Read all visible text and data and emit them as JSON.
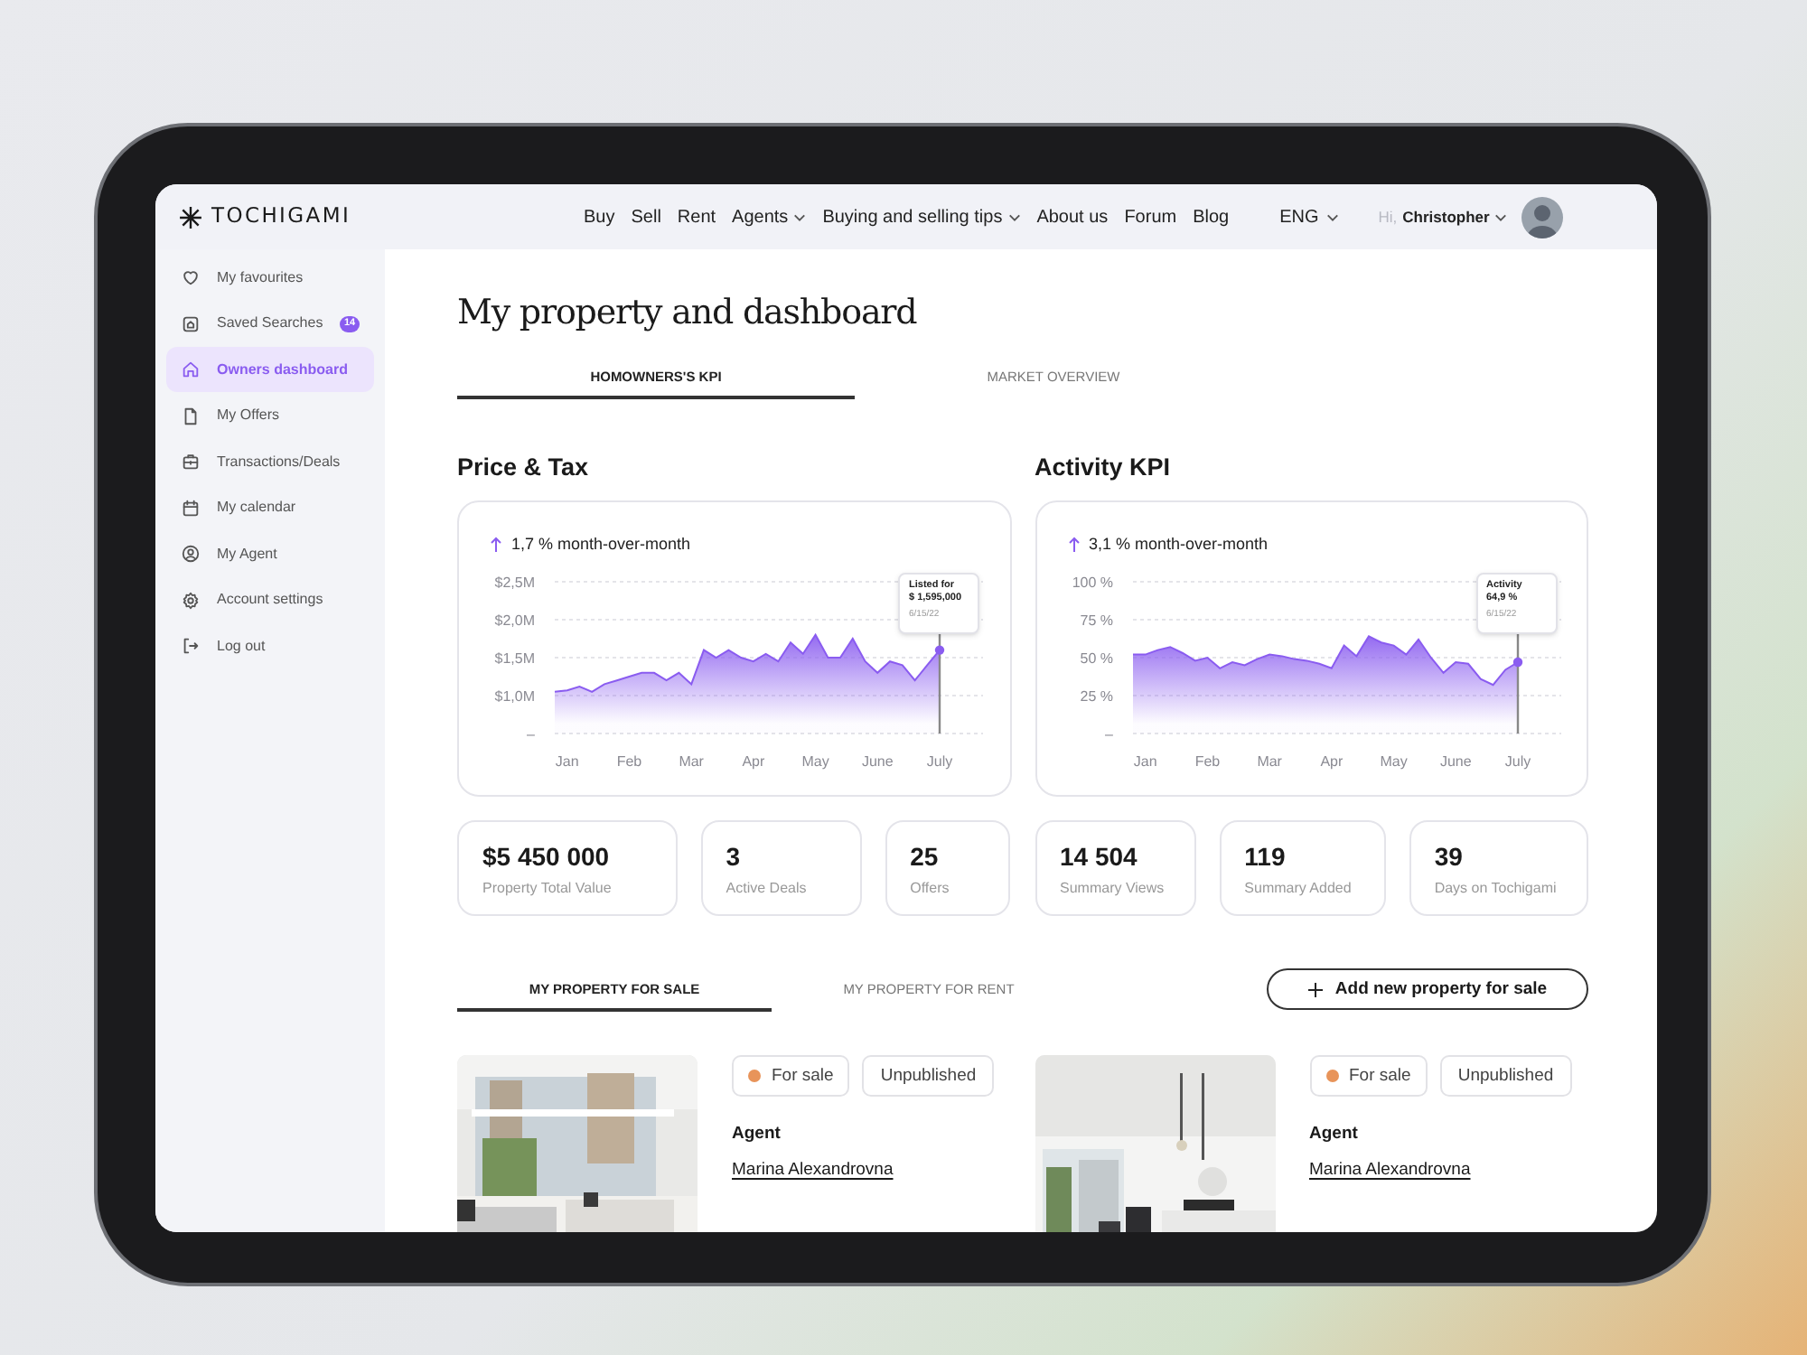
{
  "header": {
    "logo": "TOCHIGAMI",
    "nav": [
      {
        "label": "Buy",
        "dropdown": false
      },
      {
        "label": "Sell",
        "dropdown": false
      },
      {
        "label": "Rent",
        "dropdown": false
      },
      {
        "label": "Agents",
        "dropdown": true
      },
      {
        "label": "Buying and selling tips",
        "dropdown": true
      },
      {
        "label": "About us",
        "dropdown": false
      },
      {
        "label": "Forum",
        "dropdown": false
      },
      {
        "label": "Blog",
        "dropdown": false
      }
    ],
    "language": "ENG",
    "greeting": "Hi,",
    "user": "Christopher"
  },
  "sidebar": {
    "items": [
      {
        "label": "My favourites",
        "selected": false
      },
      {
        "label": "Saved Searches",
        "badge": "14",
        "selected": false
      },
      {
        "label": "Owners dashboard",
        "selected": true
      },
      {
        "label": "My Offers",
        "selected": false
      },
      {
        "label": "Transactions/Deals",
        "selected": false
      },
      {
        "label": "My calendar",
        "selected": false
      },
      {
        "label": "My Agent",
        "selected": false
      },
      {
        "label": "Account settings",
        "selected": false
      },
      {
        "label": "Log out",
        "selected": false
      }
    ]
  },
  "page_title": "My property and dashboard",
  "tabs": [
    {
      "label": "HOMOWNERS'S KPI",
      "selected": true
    },
    {
      "label": "MARKET OVERVIEW",
      "selected": false
    }
  ],
  "panels": [
    {
      "title": "Price & Tax",
      "change": "1,7 % month-over-month",
      "tooltip": {
        "label": "Listed for",
        "value": "$ 1,595,000",
        "date": "6/15/22"
      },
      "chart_data": {
        "type": "area",
        "grid": true,
        "ylim": [
          0.5,
          2.5
        ],
        "categories": [
          null,
          "Jan",
          null,
          null,
          null,
          null,
          "Feb",
          null,
          null,
          null,
          null,
          "Mar",
          null,
          null,
          null,
          null,
          "Apr",
          null,
          null,
          null,
          null,
          "May",
          null,
          null,
          null,
          null,
          "June",
          null,
          null,
          null,
          null,
          "July"
        ],
        "values": [
          1.05,
          1.07,
          1.12,
          1.05,
          1.15,
          1.2,
          1.25,
          1.3,
          1.3,
          1.2,
          1.3,
          1.15,
          1.6,
          1.5,
          1.6,
          1.5,
          1.45,
          1.55,
          1.45,
          1.7,
          1.55,
          1.8,
          1.5,
          1.5,
          1.75,
          1.45,
          1.3,
          1.45,
          1.4,
          1.2,
          1.4,
          1.6
        ],
        "yticks": [
          {
            "value": 0.5,
            "label": "–"
          },
          {
            "value": 1,
            "label": "$1,0M"
          },
          {
            "value": 1.5,
            "label": "$1,5M"
          },
          {
            "value": 2,
            "label": "$2,0M"
          },
          {
            "value": 2.5,
            "label": "$2,5M"
          }
        ]
      },
      "stats": [
        {
          "value": "$5 450 000",
          "label": "Property Total Value"
        },
        {
          "value": "3",
          "label": "Active Deals"
        },
        {
          "value": "25",
          "label": "Offers"
        }
      ]
    },
    {
      "title": "Activity KPI",
      "change": "3,1 % month-over-month",
      "tooltip": {
        "label": "Activity",
        "value": "64,9 %",
        "date": "6/15/22"
      },
      "chart_data": {
        "type": "area",
        "grid": true,
        "ylim": [
          0,
          100
        ],
        "categories": [
          null,
          "Jan",
          null,
          null,
          null,
          null,
          "Feb",
          null,
          null,
          null,
          null,
          "Mar",
          null,
          null,
          null,
          null,
          "Apr",
          null,
          null,
          null,
          null,
          "May",
          null,
          null,
          null,
          null,
          "June",
          null,
          null,
          null,
          null,
          "July"
        ],
        "values": [
          52,
          52,
          55,
          57,
          53,
          48,
          50,
          43,
          47,
          45,
          49,
          52,
          51,
          49,
          48,
          46,
          43,
          58,
          51,
          64,
          60,
          58,
          52,
          62,
          50,
          40,
          47,
          46,
          36,
          32,
          42,
          47
        ],
        "yticks": [
          {
            "value": 0,
            "label": "–"
          },
          {
            "value": 25,
            "label": "25 %"
          },
          {
            "value": 50,
            "label": "50 %"
          },
          {
            "value": 75,
            "label": "75 %"
          },
          {
            "value": 100,
            "label": "100 %"
          }
        ]
      },
      "stats": [
        {
          "value": "14 504",
          "label": "Summary Views"
        },
        {
          "value": "119",
          "label": "Summary Added"
        },
        {
          "value": "39",
          "label": "Days on Tochigami"
        }
      ]
    }
  ],
  "listing_tabs": [
    {
      "label": "MY PROPERTY FOR SALE",
      "selected": true
    },
    {
      "label": "MY PROPERTY FOR RENT",
      "selected": false
    }
  ],
  "add_button": "Add new property for sale",
  "listings": [
    {
      "kind": "picture",
      "status": "For sale",
      "color": "#e8945a",
      "publish_state": "Unpublished",
      "agent_label": "Agent",
      "agent": "Marina Alexandrovna"
    },
    {
      "kind": "picture",
      "status": "For sale",
      "color": "#e8945a",
      "publish_state": "Unpublished",
      "agent_label": "Agent",
      "agent": "Marina Alexandrovna"
    }
  ]
}
